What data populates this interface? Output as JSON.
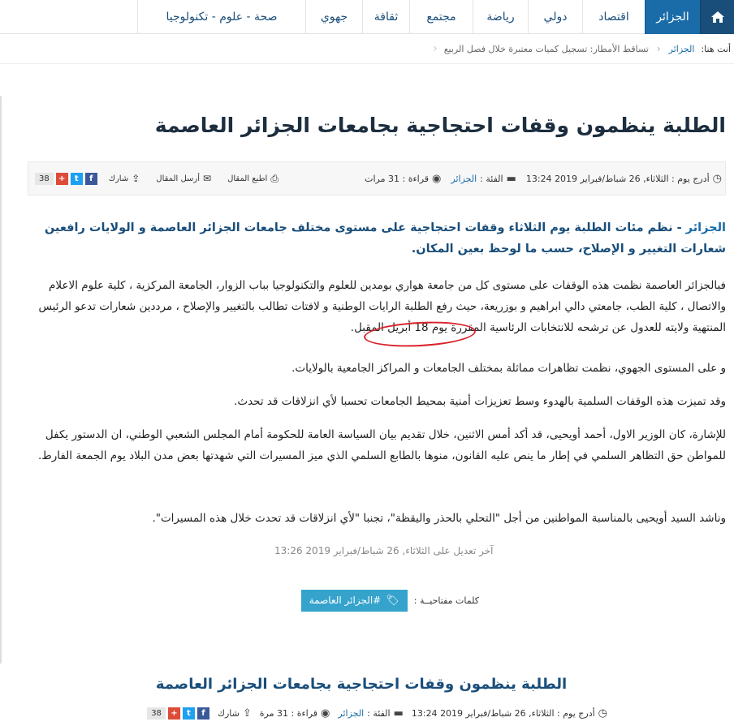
{
  "nav": {
    "home_icon": "home-icon",
    "items": [
      {
        "label": "الجزائر",
        "active": true
      },
      {
        "label": "اقتصاد"
      },
      {
        "label": "دولي"
      },
      {
        "label": "رياضة"
      },
      {
        "label": "مجتمع"
      },
      {
        "label": "ثقافة"
      },
      {
        "label": "جهوي"
      },
      {
        "label": "صحة - علوم - تكنولوجيا"
      }
    ]
  },
  "breadcrumb": {
    "label": "أنت هنا:",
    "section": "الجزائر",
    "current": "تساقط الأمطار: تسجيل كميات معتبرة خلال فصل الربيع"
  },
  "article": {
    "title": "الطلبة ينظمون وقفات احتجاجية بجامعات الجزائر العاصمة",
    "meta": {
      "posted_label": "أدرج يوم :",
      "posted_date": "الثلاثاء, 26 شباط/فبراير 2019 13:24",
      "category_label": "الفئة :",
      "category": "الجزائر",
      "reads": "قراءة : 31 مرات",
      "print_label": "اطبع المقال",
      "send_label": "أرسل المقال",
      "share_label": "شارك",
      "share_count": "38"
    },
    "lead_tag": "الجزائر",
    "lead_text": " - نظم مئات الطلبة يوم الثلاثاء وقفات احتجاجية على مستوى مختلف جامعات الجزائر العاصمة و الولايات رافعين شعارات التغيير و الإصلاح، حسب ما لوحظ بعين المكان.",
    "paragraphs": [
      "فبالجزائر العاصمة نظمت هذه الوقفات على مستوى كل من جامعة هواري بومدين للعلوم والتكنولوجيا بباب الزوار، الجامعة المركزية ، كلية علوم الاعلام والاتصال ، كلية الطب، جامعتي دالي ابراهيم و بوزريعة، حيث رفع الطلبة الرايات الوطنية و لافتات تطالب بالتغيير والإصلاح ، مرددين شعارات تدعو الرئيس المنتهية ولايته للعدول عن ترشحه للانتخابات الرئاسية المقررة يوم 18 أبريل المقبل.",
      "و على المستوى الجهوي، نظمت تظاهرات مماثلة بمختلف الجامعات و المراكز الجامعية بالولايات.",
      "وقد تميزت هذه الوقفات السلمية بالهدوء وسط تعزيزات أمنية بمحيط الجامعات تحسبا لأي انزلاقات قد تحدث.",
      "للإشارة، كان الوزير الاول، أحمد أويحيى، قد أكد أمس الاثنين، خلال تقديم بيان السياسة العامة للحكومة أمام المجلس الشعبي الوطني، ان الدستور يكفل للمواطن حق التظاهر السلمي في إطار ما ينص عليه القانون، منوها بالطابع السلمي الذي ميز المسيرات التي شهدتها بعض مدن البلاد يوم الجمعة الفارط.",
      "وناشد السيد أويحيى بالمناسبة المواطنين من أجل \"التحلي بالحذر واليقظة\"، تجنبا \"لأي انزلاقات قد تحدث خلال هذه المسيرات\"."
    ],
    "last_edited": "آخر تعديل على الثلاثاء, 26 شباط/فبراير 2019 13:26",
    "tags_label": "كلمات مفتاحيــة :",
    "tag": "#الجزائر العاصمة"
  },
  "related": {
    "title": "الطلبة ينظمون وقفات احتجاجية بجامعات الجزائر العاصمة",
    "posted_label": "أدرج يوم :",
    "posted_date": "الثلاثاء, 26 شباط/فبراير 2019 13:24",
    "category_label": "الفئة :",
    "category": "الجزائر",
    "reads": "قراءة : 31 مرة",
    "share_label": "شارك",
    "share_count": "38"
  },
  "colors": {
    "nav_active": "#1a6ca8",
    "brand_dark": "#1a4e7a",
    "tag_bg": "#35a3cc",
    "highlight_circle": "#d9222a"
  }
}
